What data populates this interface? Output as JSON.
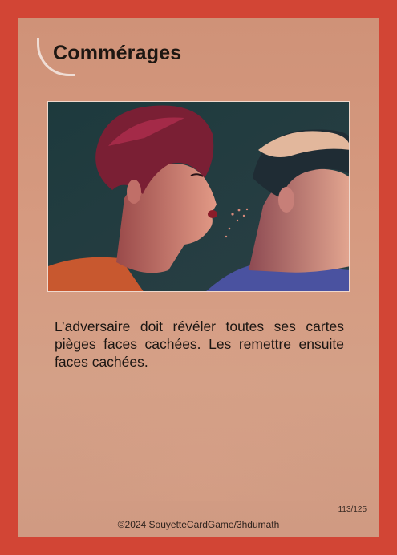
{
  "card": {
    "title": "Commérages",
    "effect_text": "L’adversaire doit révéler toutes ses cartes pièges faces cachées. Les remettre ensuite faces cachées.",
    "counter": "113/125",
    "copyright": "©2024 SouyetteCardGame/3hdumath",
    "illustration_icon": "whispering-people-illustration",
    "colors": {
      "border": "#d24535",
      "face": "#d69a80",
      "art_background": "#223c40"
    }
  }
}
